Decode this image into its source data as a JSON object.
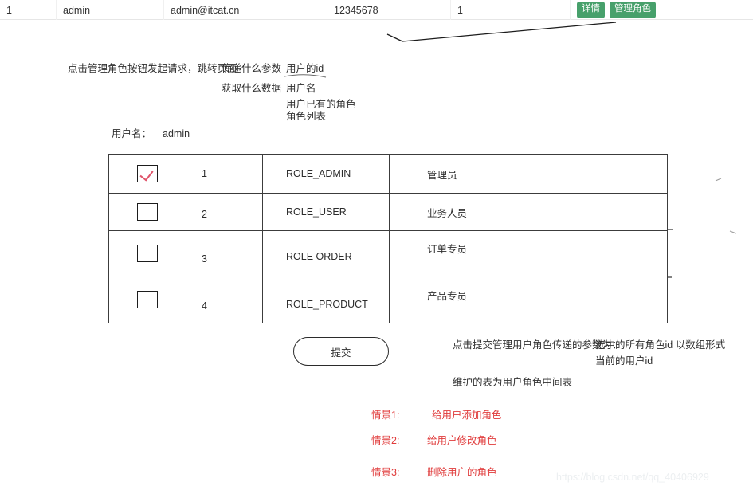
{
  "top_table": {
    "row": {
      "id": "1",
      "username": "admin",
      "email": "admin@itcat.cn",
      "phone": "12345678",
      "status": "1"
    },
    "actions": {
      "detail_label": "详情",
      "manage_role_label": "管理角色"
    },
    "accent_green": "#47a06b"
  },
  "annotations": {
    "flow_line": "点击管理角色按钮发起请求，跳转页面",
    "param_label": "传递什么参数",
    "param_value": "用户的id",
    "data_label": "获取什么数据",
    "data_values": [
      "用户名",
      "用户已有的角色",
      "角色列表"
    ],
    "username_label": "用户名：",
    "username_value": "admin"
  },
  "roles_table": {
    "rows": [
      {
        "checked": true,
        "id": "1",
        "name": "ROLE_ADMIN",
        "desc": "管理员"
      },
      {
        "checked": false,
        "id": "2",
        "name": "ROLE_USER",
        "desc": "业务人员"
      },
      {
        "checked": false,
        "id": "3",
        "name": "ROLE ORDER",
        "desc": "订单专员"
      },
      {
        "checked": false,
        "id": "4",
        "name": "ROLE_PRODUCT",
        "desc": "产品专员"
      }
    ]
  },
  "submit": {
    "label": "提交"
  },
  "notes": {
    "submit_param_label": "点击提交管理用户角色传递的参数为：",
    "submit_param_value_1": "选中的所有角色id 以数组形式",
    "submit_param_value_2": "当前的用户id",
    "maintained_table": "维护的表为用户角色中间表"
  },
  "scenarios": {
    "accent_red": "#e03b3b",
    "items": [
      {
        "label": "情景1:",
        "value": "给用户添加角色"
      },
      {
        "label": "情景2:",
        "value": "给用户修改角色"
      },
      {
        "label": "情景3:",
        "value": "删除用户的角色"
      }
    ]
  },
  "watermark": {
    "text": "https://blog.csdn.net/qq_40406929"
  }
}
